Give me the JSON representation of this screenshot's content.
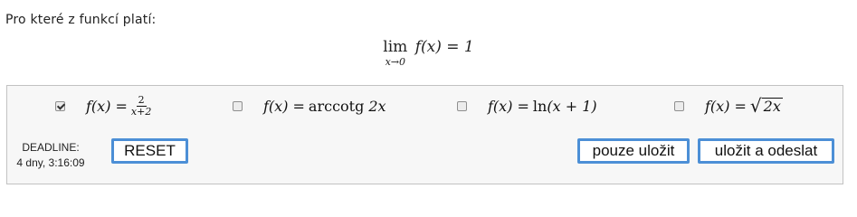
{
  "question": {
    "prompt": "Pro které z funkcí platí:",
    "limit": {
      "operator": "lim",
      "subscript": "x→0",
      "expression": "f(x) = 1"
    }
  },
  "options": [
    {
      "checked": true,
      "lhs": "f(x) = ",
      "numerator": "2",
      "denominator": "x+2"
    },
    {
      "checked": false,
      "lhs": "f(x) = ",
      "func": "arccotg",
      "arg": "2x"
    },
    {
      "checked": false,
      "lhs": "f(x) = ",
      "func": "ln",
      "arg": "(x + 1)"
    },
    {
      "checked": false,
      "lhs": "f(x) = ",
      "radicand": "2x"
    }
  ],
  "deadline": {
    "label": "DEADLINE:",
    "remaining": "4 dny, 3:16:09"
  },
  "buttons": {
    "reset": "RESET",
    "save": "pouze uložit",
    "save_send": "uložit a odeslat"
  },
  "colors": {
    "button_border": "#4c8fd6",
    "panel_background": "#f7f7f7",
    "panel_border": "#c2c2c2"
  }
}
